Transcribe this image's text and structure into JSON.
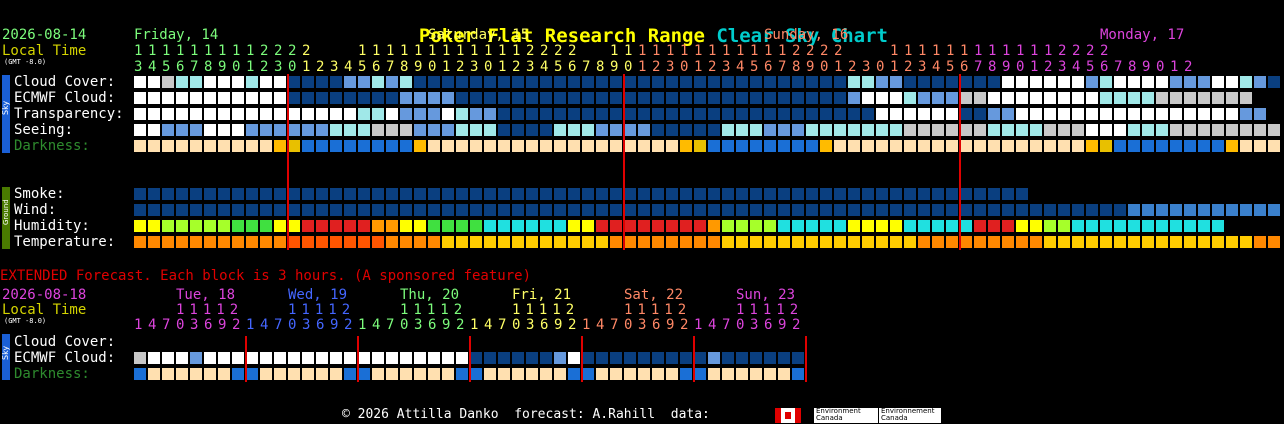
{
  "title": {
    "part1": "Poker Flat Research Range",
    "part2": "Clear Sky Chart"
  },
  "colors": {
    "title_yellow": "#ffff00",
    "title_cyan": "#00cccc",
    "date_green": "#7cfc7c",
    "local_yellow": "#d4d400",
    "red_line": "#e00000",
    "extended_red": "#e00000"
  },
  "main": {
    "date": "2026-08-14",
    "local_time": "Local Time",
    "gmt": "(GMT -8.0)",
    "days": [
      {
        "label": "Friday, 14",
        "color": "#7cfc7c"
      },
      {
        "label": "Saturday, 15",
        "color": "#ffff66"
      },
      {
        "label": "Sunday, 16",
        "color": "#ff8866"
      },
      {
        "label": "Monday, 17",
        "color": "#dd44dd"
      }
    ],
    "hours_top": "1111111112222   1111111111112222  11111111111112222   1111111111112222",
    "hours_bottom": "3456789012301234567890123012345678901230123456789012301234567890123456789012",
    "sky_side": "Sky",
    "ground_side": "Ground",
    "sky_labels": [
      "Cloud Cover:",
      "ECMWF Cloud:",
      "Transparency:",
      "Seeing:",
      "Darkness:"
    ],
    "ground_labels": [
      "Smoke:",
      "Wind:",
      "Humidity:",
      "Temperature:"
    ]
  },
  "extended": {
    "notice": "EXTENDED Forecast. Each block is 3 hours. (A sponsored feature)",
    "date": "2026-08-18",
    "local_time": "Local Time",
    "gmt": "(GMT -8.0)",
    "days": [
      {
        "label": "Tue, 18",
        "top": "11112",
        "color": "#dd44dd"
      },
      {
        "label": "Wed, 19",
        "top": "11112",
        "color": "#4466ff"
      },
      {
        "label": "Thu, 20",
        "top": "11112",
        "color": "#7cfc7c"
      },
      {
        "label": "Fri, 21",
        "top": "11112",
        "color": "#ffff66"
      },
      {
        "label": "Sat, 22",
        "top": "11112",
        "color": "#ff8866"
      },
      {
        "label": "Sun, 23",
        "top": "11112",
        "color": "#dd44dd"
      }
    ],
    "hours": "147036921470369214703692147036921470369214703692",
    "sky_side": "Sky",
    "sky_labels": [
      "Cloud Cover:",
      "ECMWF Cloud:",
      "Darkness:"
    ]
  },
  "footer": {
    "copyright": "© 2026 Attilla Danko",
    "forecast": "forecast: A.Rahill",
    "data": "data:",
    "env1": "Environment Canada",
    "env2": "Environnement Canada"
  },
  "grid_rows": {
    "cloud_cover": "WWGCCWWWCWWDDDDBBCBCDDDDDDDDDDDDDDDDDDDDDDDDDDDDDDDCCBBDDDDDDDWWWWWWBCWWWWBBBWWCBDDDBWCBB",
    "ecmwf_cloud": "WWWWWWWWWWWDDDDDDDDBBBBDDDDDDDDDDDDDDDDDDDDDDDDDDDDBWWWCBBBGGWWWWWWWWCCCCGGGGGGG",
    "transparency": "WWWWWWWWWWWWWWWWCCWBBBWCBBDDDDDDDDDDDDDDDDDDDDDDDDDDDWWWWWWDDBBWWWWWWWWWWWWWWWWBB",
    "seeing": "WWBBBWWWBBBBBBCCCGGGBBBCCCDDDDCCCBBBBDDDDDCCCBBBCCCCCCCGGGGGGCCCCGGGWWWCCCGGGGGGGGGC",
    "darkness": "YYYYYYYYYYOMBBBBBBBBOYYYYYYYYYYYYYYYYYYOMBBBBBBBBOYYYYYYYYYYYYYYYYYYOMBBBBBBBBOYYYYYYYYYYYYYYYYYOMB",
    "smoke": "DDDDDDDDDDDDDDDDDDDDDDDDDDDDDDDDDDDDDDDDDDDDDDDDDDDDDDDDDDDDDDDDDDDDDDDDDDD",
    "wind": "DDDDDDDDDDDDDDDDDDDDDDDDDDDDDDDDDDDDDDDDDDDDDDDDDDDDDDDDDDDDDDDDDDDDDDDBBBBBBBBBBBBBBBBBBBBB",
    "humidity": "YYLLLLLGGGYYRRRRROOYYGGGGCCCCCCYYRRRRRRRROLLLLCCCCCYYYYCCCCCRRRYYLLCCCCCCCCCCC",
    "temperature": "OOOOOOOOOOORRRRRRROOOOYYYYYYYYYYYYOOOOOOOOYYYYYYYYYYYYYYOOOOOOOOOYYYYYYYYYYYYYYYOOOO",
    "ext_cloud": "GWWWBWWWWWWWWWWWWWWWWWWWDDDDDDBWDDDDDDDDDBDDDDDDC",
    "ext_ecmwf": "",
    "ext_darkness": "BYYYYYYBBYYYYYYBBYYYYYYBBYYYYYYBBYYYYYYBBYYYYYYB"
  }
}
